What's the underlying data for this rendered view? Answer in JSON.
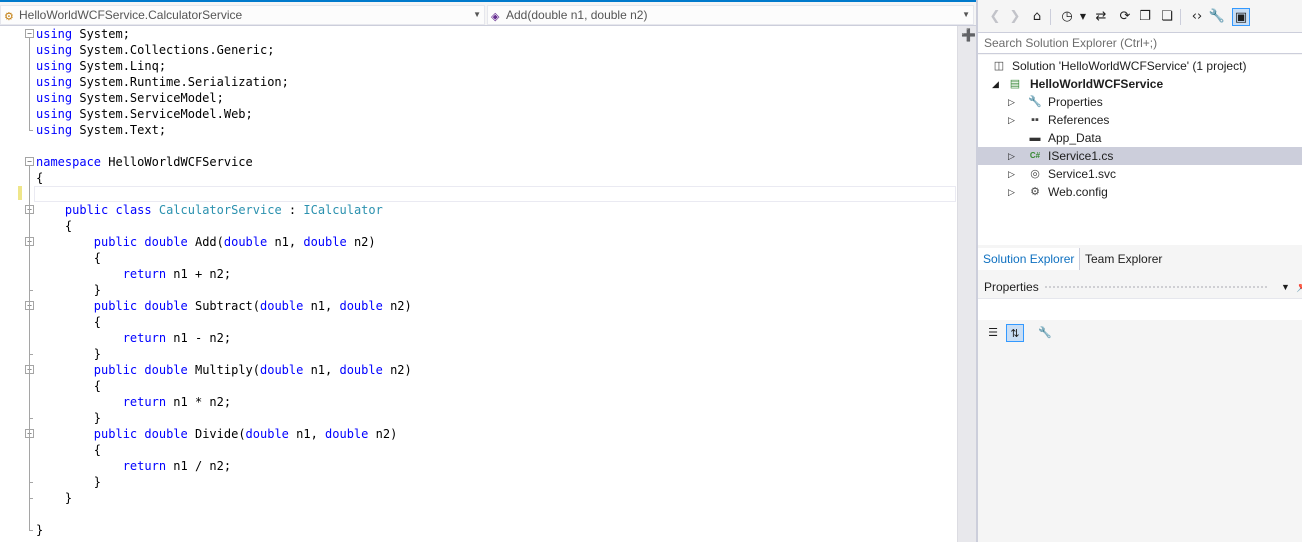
{
  "navbar": {
    "type_combo": "HelloWorldWCFService.CalculatorService",
    "member_combo": "Add(double n1, double n2)"
  },
  "code_lines": [
    [
      {
        "k": "kw",
        "t": "using"
      },
      {
        "k": "",
        "t": " System;"
      }
    ],
    [
      {
        "k": "kw",
        "t": "using"
      },
      {
        "k": "",
        "t": " System.Collections.Generic;"
      }
    ],
    [
      {
        "k": "kw",
        "t": "using"
      },
      {
        "k": "",
        "t": " System.Linq;"
      }
    ],
    [
      {
        "k": "kw",
        "t": "using"
      },
      {
        "k": "",
        "t": " System.Runtime.Serialization;"
      }
    ],
    [
      {
        "k": "kw",
        "t": "using"
      },
      {
        "k": "",
        "t": " System.ServiceModel;"
      }
    ],
    [
      {
        "k": "kw",
        "t": "using"
      },
      {
        "k": "",
        "t": " System.ServiceModel.Web;"
      }
    ],
    [
      {
        "k": "kw",
        "t": "using"
      },
      {
        "k": "",
        "t": " System.Text;"
      }
    ],
    [],
    [
      {
        "k": "kw",
        "t": "namespace"
      },
      {
        "k": "",
        "t": " HelloWorldWCFService"
      }
    ],
    [
      {
        "k": "",
        "t": "{"
      }
    ],
    [],
    [
      {
        "k": "",
        "t": "    "
      },
      {
        "k": "kw",
        "t": "public"
      },
      {
        "k": "",
        "t": " "
      },
      {
        "k": "kw",
        "t": "class"
      },
      {
        "k": "",
        "t": " "
      },
      {
        "k": "ty",
        "t": "CalculatorService"
      },
      {
        "k": "",
        "t": " : "
      },
      {
        "k": "ty",
        "t": "ICalculator"
      }
    ],
    [
      {
        "k": "",
        "t": "    {"
      }
    ],
    [
      {
        "k": "",
        "t": "        "
      },
      {
        "k": "kw",
        "t": "public"
      },
      {
        "k": "",
        "t": " "
      },
      {
        "k": "kw",
        "t": "double"
      },
      {
        "k": "",
        "t": " Add("
      },
      {
        "k": "kw",
        "t": "double"
      },
      {
        "k": "",
        "t": " n1, "
      },
      {
        "k": "kw",
        "t": "double"
      },
      {
        "k": "",
        "t": " n2)"
      }
    ],
    [
      {
        "k": "",
        "t": "        {"
      }
    ],
    [
      {
        "k": "",
        "t": "            "
      },
      {
        "k": "kw",
        "t": "return"
      },
      {
        "k": "",
        "t": " n1 + n2;"
      }
    ],
    [
      {
        "k": "",
        "t": "        }"
      }
    ],
    [
      {
        "k": "",
        "t": "        "
      },
      {
        "k": "kw",
        "t": "public"
      },
      {
        "k": "",
        "t": " "
      },
      {
        "k": "kw",
        "t": "double"
      },
      {
        "k": "",
        "t": " Subtract("
      },
      {
        "k": "kw",
        "t": "double"
      },
      {
        "k": "",
        "t": " n1, "
      },
      {
        "k": "kw",
        "t": "double"
      },
      {
        "k": "",
        "t": " n2)"
      }
    ],
    [
      {
        "k": "",
        "t": "        {"
      }
    ],
    [
      {
        "k": "",
        "t": "            "
      },
      {
        "k": "kw",
        "t": "return"
      },
      {
        "k": "",
        "t": " n1 - n2;"
      }
    ],
    [
      {
        "k": "",
        "t": "        }"
      }
    ],
    [
      {
        "k": "",
        "t": "        "
      },
      {
        "k": "kw",
        "t": "public"
      },
      {
        "k": "",
        "t": " "
      },
      {
        "k": "kw",
        "t": "double"
      },
      {
        "k": "",
        "t": " Multiply("
      },
      {
        "k": "kw",
        "t": "double"
      },
      {
        "k": "",
        "t": " n1, "
      },
      {
        "k": "kw",
        "t": "double"
      },
      {
        "k": "",
        "t": " n2)"
      }
    ],
    [
      {
        "k": "",
        "t": "        {"
      }
    ],
    [
      {
        "k": "",
        "t": "            "
      },
      {
        "k": "kw",
        "t": "return"
      },
      {
        "k": "",
        "t": " n1 * n2;"
      }
    ],
    [
      {
        "k": "",
        "t": "        }"
      }
    ],
    [
      {
        "k": "",
        "t": "        "
      },
      {
        "k": "kw",
        "t": "public"
      },
      {
        "k": "",
        "t": " "
      },
      {
        "k": "kw",
        "t": "double"
      },
      {
        "k": "",
        "t": " Divide("
      },
      {
        "k": "kw",
        "t": "double"
      },
      {
        "k": "",
        "t": " n1, "
      },
      {
        "k": "kw",
        "t": "double"
      },
      {
        "k": "",
        "t": " n2)"
      }
    ],
    [
      {
        "k": "",
        "t": "        {"
      }
    ],
    [
      {
        "k": "",
        "t": "            "
      },
      {
        "k": "kw",
        "t": "return"
      },
      {
        "k": "",
        "t": " n1 / n2;"
      }
    ],
    [
      {
        "k": "",
        "t": "        }"
      }
    ],
    [
      {
        "k": "",
        "t": "    }"
      }
    ],
    [],
    [
      {
        "k": "",
        "t": "}"
      }
    ]
  ],
  "solution_explorer": {
    "search_placeholder": "Search Solution Explorer (Ctrl+;)",
    "tree": [
      {
        "label": "Solution 'HelloWorldWCFService' (1 project)",
        "icon": "solution-icon",
        "expander": "none",
        "selected": false
      },
      {
        "label": "HelloWorldWCFService",
        "icon": "web-project-icon",
        "expander": "expanded",
        "selected": false,
        "bold": true
      },
      {
        "label": "Properties",
        "icon": "wrench-icon",
        "expander": "collapsed",
        "selected": false
      },
      {
        "label": "References",
        "icon": "references-icon",
        "expander": "collapsed",
        "selected": false
      },
      {
        "label": "App_Data",
        "icon": "folder-icon",
        "expander": "none",
        "selected": false
      },
      {
        "label": "IService1.cs",
        "icon": "csharp-file-icon",
        "expander": "collapsed",
        "selected": true
      },
      {
        "label": "Service1.svc",
        "icon": "svc-file-icon",
        "expander": "collapsed",
        "selected": false
      },
      {
        "label": "Web.config",
        "icon": "config-file-icon",
        "expander": "collapsed",
        "selected": false
      }
    ],
    "tabs": {
      "solution": "Solution Explorer",
      "team": "Team Explorer"
    }
  },
  "properties": {
    "title": "Properties"
  },
  "colors": {
    "keyword": "#0000ff",
    "type": "#2b91af",
    "accent": "#007acc",
    "selection": "#cccedb"
  }
}
